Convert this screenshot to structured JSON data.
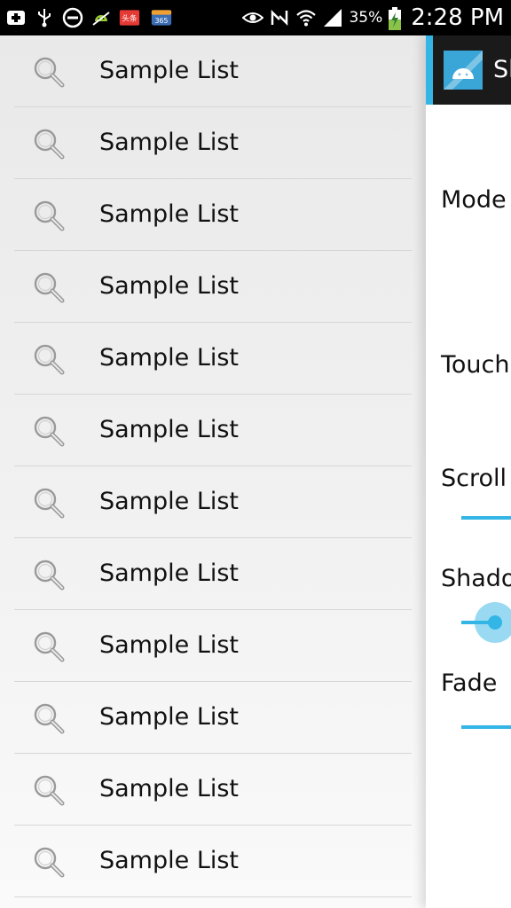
{
  "status_bar": {
    "battery_percent": "35%",
    "time": "2:28 PM",
    "notification_badge": "头条",
    "calendar_badge": "365",
    "icons": [
      "add-notification-icon",
      "usb-icon",
      "do-not-disturb-icon",
      "android-debug-icon",
      "news-app-icon",
      "calendar-365-icon",
      "eye-icon",
      "nfc-icon",
      "wifi-icon",
      "signal-icon",
      "battery-charging-icon"
    ]
  },
  "menu": {
    "items": [
      {
        "label": "Sample List",
        "icon": "search-icon"
      },
      {
        "label": "Sample List",
        "icon": "search-icon"
      },
      {
        "label": "Sample List",
        "icon": "search-icon"
      },
      {
        "label": "Sample List",
        "icon": "search-icon"
      },
      {
        "label": "Sample List",
        "icon": "search-icon"
      },
      {
        "label": "Sample List",
        "icon": "search-icon"
      },
      {
        "label": "Sample List",
        "icon": "search-icon"
      },
      {
        "label": "Sample List",
        "icon": "search-icon"
      },
      {
        "label": "Sample List",
        "icon": "search-icon"
      },
      {
        "label": "Sample List",
        "icon": "search-icon"
      },
      {
        "label": "Sample List",
        "icon": "search-icon"
      },
      {
        "label": "Sample List",
        "icon": "search-icon"
      }
    ]
  },
  "content": {
    "action_bar_title": "Sl",
    "settings": {
      "mode_label": "Mode",
      "touch_label": "Touch",
      "scroll_label": "Scroll",
      "shadow_label": "Shado",
      "fade_label": "Fade"
    }
  },
  "colors": {
    "accent": "#33b5e5",
    "status_bar_bg": "#000000",
    "action_bar_bg": "#1a1a1a"
  }
}
